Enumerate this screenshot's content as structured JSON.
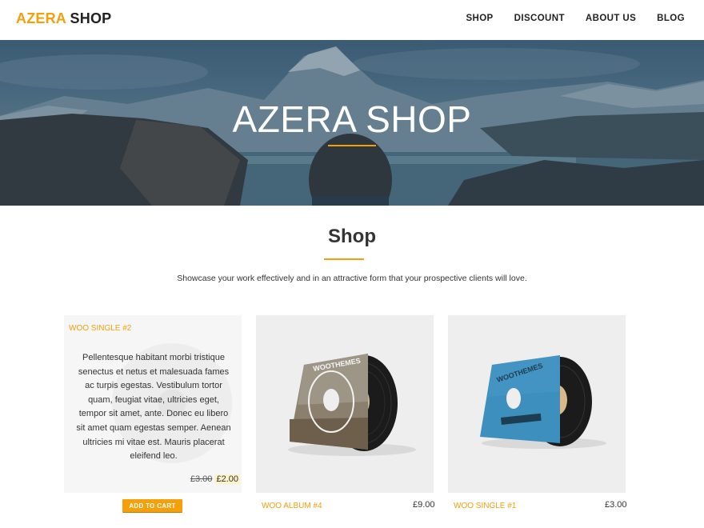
{
  "header": {
    "logo_accent": "AZERA",
    "logo_dark": "SHOP",
    "nav": [
      "SHOP",
      "DISCOUNT",
      "ABOUT US",
      "BLOG"
    ]
  },
  "hero": {
    "title": "AZERA SHOP"
  },
  "section": {
    "title": "Shop",
    "subtitle": "Showcase your work effectively and in an attractive form that your prospective clients will love."
  },
  "products": [
    {
      "category": "WOO SINGLE #2",
      "description": "Pellentesque habitant morbi tristique senectus et netus et malesuada fames ac turpis egestas. Vestibulum tortor quam, feugiat vitae, ultricies eget, tempor sit amet, ante. Donec eu libero sit amet quam egestas semper. Aenean ultricies mi vitae est. Mauris placerat eleifend leo.",
      "old_price": "£3.00",
      "price": "£2.00",
      "button": "ADD TO CART"
    },
    {
      "category": "WOO ALBUM #4",
      "price": "£9.00",
      "sleeve_text": "WOOTHEMES"
    },
    {
      "category": "WOO SINGLE #1",
      "price": "£3.00",
      "sleeve_text": "WOOTHEMES"
    }
  ],
  "colors": {
    "accent": "#f5a00a",
    "text": "#333333",
    "sleeve_blue": "#3d8fbd"
  }
}
